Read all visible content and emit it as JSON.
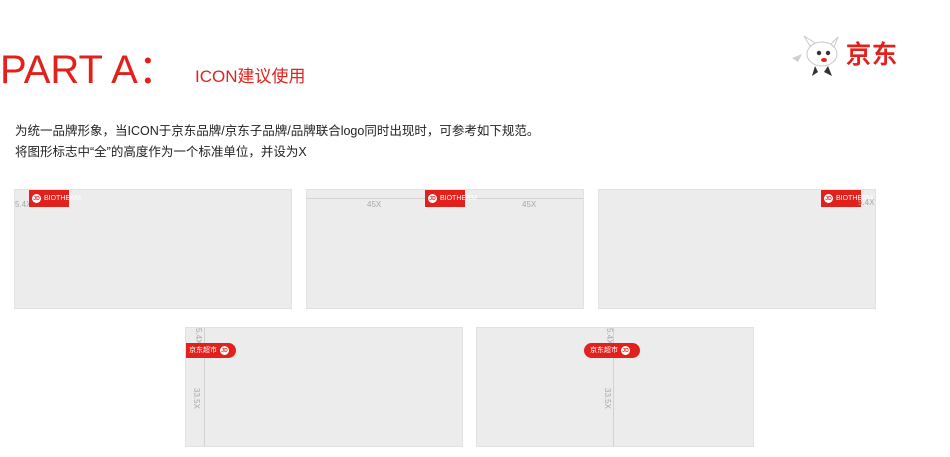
{
  "header": {
    "title": "PART A：",
    "subtitle": "ICON建议使用",
    "brand_name": "京东"
  },
  "description": {
    "line1": "为统一品牌形象，当ICON于京东品牌/京东子品牌/品牌联合logo同时出现时，可参考如下规范。",
    "line2": "将图形标志中“全”的高度作为一个标准单位，并设为X"
  },
  "panels": {
    "p1": {
      "measure_left": "5.4X",
      "logo_text": "BIOTHERM"
    },
    "p2": {
      "measure_left": "45X",
      "measure_right": "45X",
      "logo_text": "BIOTHERM"
    },
    "p3": {
      "measure_right": "5.4X",
      "logo_text": "BIOTHERM"
    },
    "p4": {
      "measure_top": "5.4X",
      "measure_side": "33.5X",
      "tag_text": "京东超市"
    },
    "p5": {
      "measure_top": "5.4X",
      "measure_side": "33.5X",
      "tag_text": "京东超市"
    }
  },
  "colors": {
    "brand_red": "#e3211c",
    "panel_gray": "#ececec"
  }
}
